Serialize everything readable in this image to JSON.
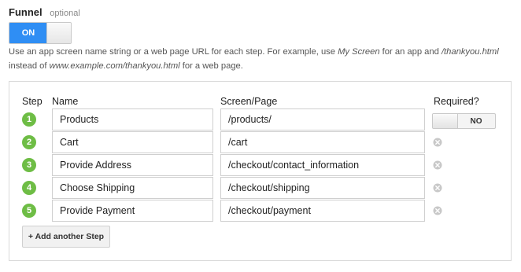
{
  "funnel": {
    "title": "Funnel",
    "optional_label": "optional",
    "toggle_label": "ON",
    "help": {
      "text1": "Use an app screen name string or a web page URL for each step. For example, use ",
      "example_screen": "My Screen",
      "text2": " for an app and ",
      "example_path": "/thankyou.html",
      "text3": " instead of ",
      "example_url": "www.example.com/thankyou.html",
      "text4": " for a web page."
    }
  },
  "table": {
    "headers": {
      "step": "Step",
      "name": "Name",
      "page": "Screen/Page",
      "required": "Required?"
    },
    "steps": [
      {
        "number": "1",
        "name": "Products",
        "page": "/products/",
        "required": "NO"
      },
      {
        "number": "2",
        "name": "Cart",
        "page": "/cart"
      },
      {
        "number": "3",
        "name": "Provide Address",
        "page": "/checkout/contact_information"
      },
      {
        "number": "4",
        "name": "Choose Shipping",
        "page": "/checkout/shipping"
      },
      {
        "number": "5",
        "name": "Provide Payment",
        "page": "/checkout/payment"
      }
    ],
    "add_step_label": "+ Add another Step"
  },
  "colors": {
    "toggle_on": "#2f8ef4",
    "step_badge": "#6ebd45",
    "remove_icon": "#c8c8c8"
  },
  "icons": {
    "remove": "close-circle-icon"
  }
}
